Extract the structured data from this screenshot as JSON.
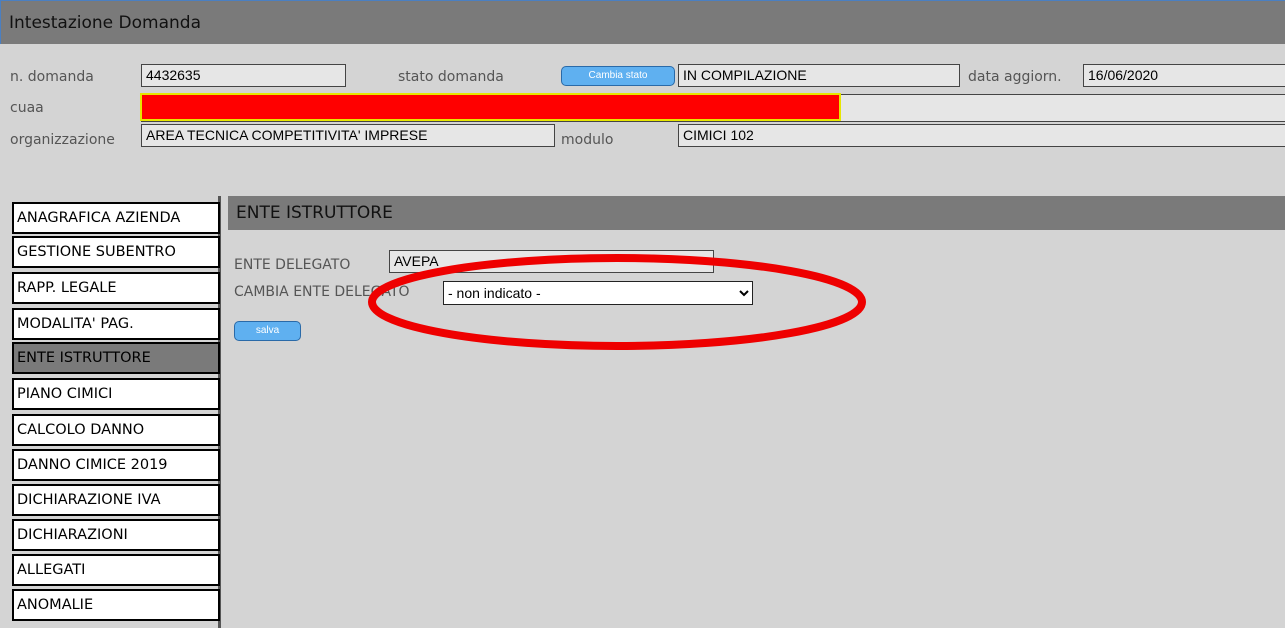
{
  "header": {
    "title": "Intestazione Domanda",
    "numero_label": "n. domanda",
    "numero_value": "4432635",
    "stato_label": "stato domanda",
    "cambia_stato_label": "Cambia stato",
    "stato_value": "IN COMPILAZIONE",
    "data_label": "data aggiorn.",
    "data_value": "16/06/2020",
    "cuaa_label": "cuaa",
    "cuaa_value": "",
    "organizzazione_label": "organizzazione",
    "organizzazione_value": "AREA TECNICA COMPETITIVITA' IMPRESE",
    "modulo_label": "modulo",
    "modulo_value": "CIMICI 102"
  },
  "sidebar": {
    "items": [
      {
        "label": "ANAGRAFICA AZIENDA"
      },
      {
        "label": "GESTIONE SUBENTRO"
      },
      {
        "label": "RAPP. LEGALE"
      },
      {
        "label": "MODALITA' PAG."
      },
      {
        "label": "ENTE ISTRUTTORE"
      },
      {
        "label": "PIANO CIMICI"
      },
      {
        "label": "CALCOLO DANNO"
      },
      {
        "label": "DANNO CIMICE 2019"
      },
      {
        "label": "DICHIARAZIONE IVA"
      },
      {
        "label": "DICHIARAZIONI"
      },
      {
        "label": "ALLEGATI"
      },
      {
        "label": "ANOMALIE"
      }
    ],
    "active_index": 4
  },
  "main": {
    "section_title": "ENTE ISTRUTTORE",
    "ente_delegato_label": "ENTE DELEGATO",
    "ente_delegato_value": "AVEPA",
    "cambia_ente_label": "CAMBIA ENTE DELEGATO",
    "cambia_ente_selected": "- non indicato -",
    "save_label": "salva"
  },
  "colors": {
    "redaction": "#ff0000",
    "redaction_border": "#e6e600",
    "annotation_ellipse": "#ee0000",
    "header_bar": "#7a7a7a",
    "button": "#5fb0f0"
  }
}
